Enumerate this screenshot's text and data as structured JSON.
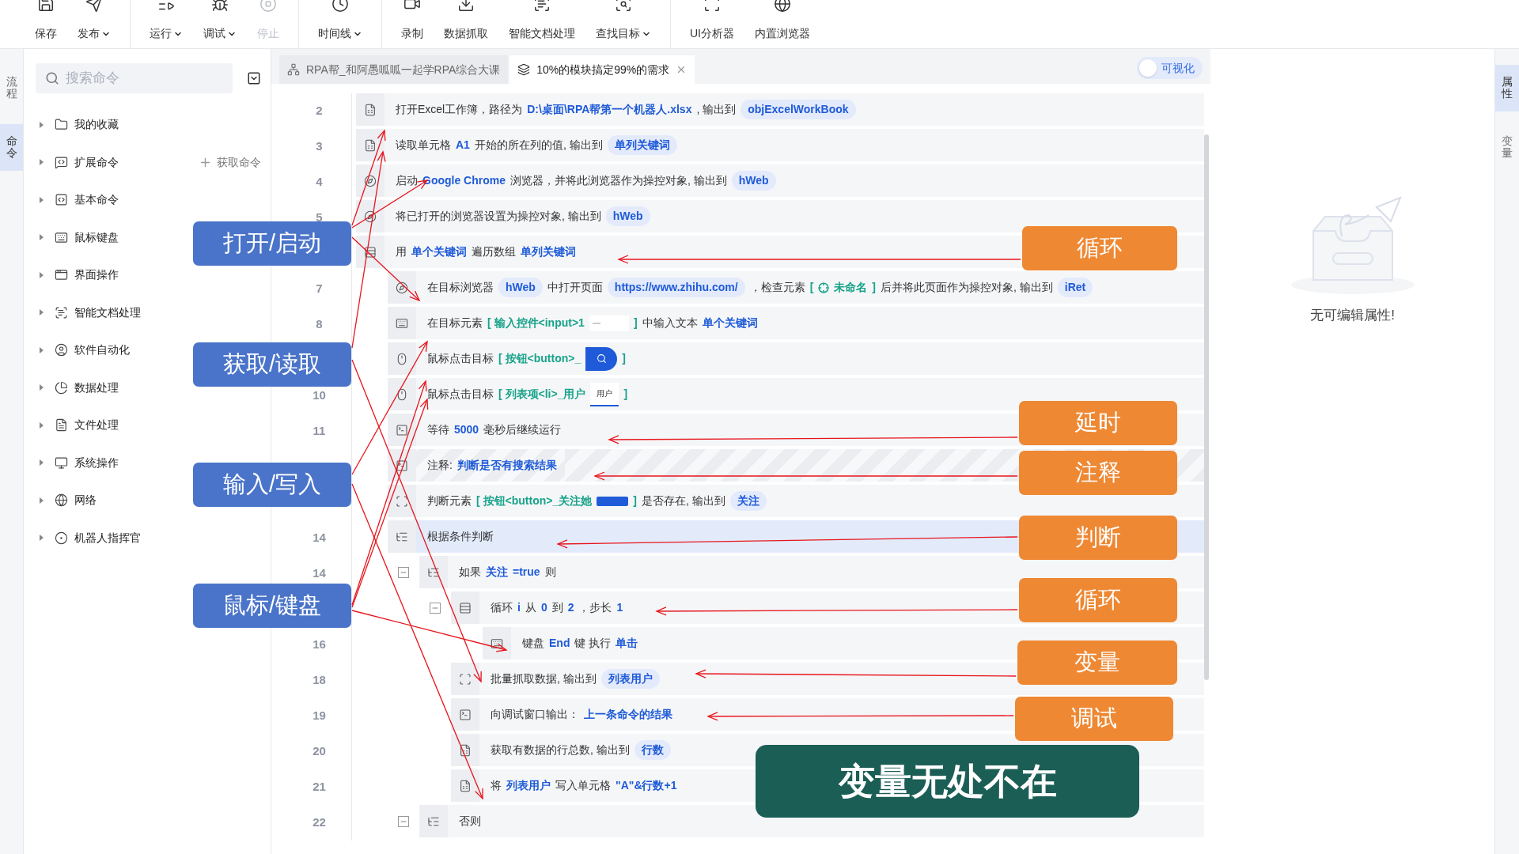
{
  "toolbar": [
    [
      {
        "label": "保存",
        "dropdown": false,
        "disabled": false
      },
      {
        "label": "发布",
        "dropdown": true,
        "disabled": false
      }
    ],
    [
      {
        "label": "运行",
        "dropdown": true,
        "disabled": false
      },
      {
        "label": "调试",
        "dropdown": true,
        "disabled": false
      },
      {
        "label": "停止",
        "dropdown": false,
        "disabled": true
      }
    ],
    [
      {
        "label": "时间线",
        "dropdown": true,
        "disabled": false
      }
    ],
    [
      {
        "label": "录制",
        "dropdown": false,
        "disabled": false
      },
      {
        "label": "数据抓取",
        "dropdown": false,
        "disabled": false
      },
      {
        "label": "智能文档处理",
        "dropdown": false,
        "disabled": false
      },
      {
        "label": "查找目标",
        "dropdown": true,
        "disabled": false
      }
    ],
    [
      {
        "label": "UI分析器",
        "dropdown": false,
        "disabled": false
      },
      {
        "label": "内置浏览器",
        "dropdown": false,
        "disabled": false
      }
    ]
  ],
  "side_tabs": [
    {
      "label": "流程",
      "selected": false
    },
    {
      "label": "命令",
      "selected": true
    }
  ],
  "search": {
    "placeholder": "搜索命令"
  },
  "command_tree": [
    {
      "label": "我的收藏"
    },
    {
      "label": "扩展命令",
      "action": "获取命令"
    },
    {
      "label": "基本命令"
    },
    {
      "label": "鼠标键盘"
    },
    {
      "label": "界面操作"
    },
    {
      "label": "智能文档处理"
    },
    {
      "label": "软件自动化"
    },
    {
      "label": "数据处理"
    },
    {
      "label": "文件处理"
    },
    {
      "label": "系统操作"
    },
    {
      "label": "网络"
    },
    {
      "label": "机器人指挥官"
    }
  ],
  "editor_tabs": [
    {
      "label": "RPA帮_和阿愚呱呱一起学RPA综合大课",
      "selected": false,
      "closable": false
    },
    {
      "label": "10%的模块搞定99%的需求",
      "selected": true,
      "closable": true
    }
  ],
  "visual_toggle": {
    "label": "可视化",
    "on": false
  },
  "rows": [
    {
      "number": "2",
      "kind": "excel",
      "selected": false,
      "parts": [
        {
          "kind": "text",
          "text": "打开Excel工作簿，路径为"
        },
        {
          "kind": "var",
          "text": "D:\\桌面\\RPA帮第一个机器人.xlsx"
        },
        {
          "kind": "text",
          "text": ", 输出到"
        },
        {
          "kind": "pill",
          "text": "objExcelWorkBook"
        }
      ]
    },
    {
      "number": "3",
      "kind": "excel",
      "selected": false,
      "parts": [
        {
          "kind": "text",
          "text": "读取单元格"
        },
        {
          "kind": "var",
          "text": "A1"
        },
        {
          "kind": "text",
          "text": "开始的所在列的值, 输出到"
        },
        {
          "kind": "pill",
          "text": "单列关键词"
        }
      ]
    },
    {
      "number": "4",
      "kind": "browser",
      "selected": false,
      "parts": [
        {
          "kind": "text",
          "text": "启动"
        },
        {
          "kind": "var",
          "text": "Google Chrome"
        },
        {
          "kind": "text",
          "text": "浏览器，并将此浏览器作为操控对象, 输出到"
        },
        {
          "kind": "pill",
          "text": "hWeb"
        }
      ]
    },
    {
      "number": "5",
      "kind": "browser",
      "selected": false,
      "parts": [
        {
          "kind": "text",
          "text": "将已打开的浏览器设置为操控对象, 输出到"
        },
        {
          "kind": "pill",
          "text": "hWeb"
        }
      ]
    },
    {
      "kind": "loop",
      "selected": false,
      "parts": [
        {
          "kind": "text",
          "text": "用"
        },
        {
          "kind": "var",
          "text": "单个关键词"
        },
        {
          "kind": "text",
          "text": "遍历数组"
        },
        {
          "kind": "var",
          "text": "单列关键词"
        }
      ],
      "children": [
        {
          "number": "7",
          "kind": "browser",
          "selected": false,
          "parts": [
            {
              "kind": "text",
              "text": "在目标浏览器"
            },
            {
              "kind": "pill",
              "text": "hWeb"
            },
            {
              "kind": "text",
              "text": "中打开页面"
            },
            {
              "kind": "pill",
              "text": "https://www.zhihu.com/"
            },
            {
              "kind": "text",
              "text": "，检查元素"
            },
            {
              "kind": "elem",
              "text": "["
            },
            {
              "kind": "target"
            },
            {
              "kind": "elem",
              "text": "未命名"
            },
            {
              "kind": "elem",
              "text": "]"
            },
            {
              "kind": "text",
              "text": "后并将此页面作为操控对象, 输出到"
            },
            {
              "kind": "pill",
              "text": "iRet"
            }
          ]
        },
        {
          "number": "8",
          "kind": "keyboard",
          "selected": false,
          "parts": [
            {
              "kind": "text",
              "text": "在目标元素"
            },
            {
              "kind": "elem",
              "text": "[ 输入控件<input>1"
            },
            {
              "kind": "thumb_input"
            },
            {
              "kind": "elem",
              "text": "]"
            },
            {
              "kind": "text",
              "text": "中输入文本"
            },
            {
              "kind": "var",
              "text": "单个关键词"
            }
          ]
        },
        {
          "kind": "mouse",
          "selected": false,
          "parts": [
            {
              "kind": "text",
              "text": "鼠标点击目标"
            },
            {
              "kind": "elem",
              "text": "[ 按钮<button>_"
            },
            {
              "kind": "thumb_search"
            },
            {
              "kind": "elem",
              "text": "]"
            }
          ]
        },
        {
          "number": "10",
          "kind": "mouse",
          "selected": false,
          "parts": [
            {
              "kind": "text",
              "text": "鼠标点击目标"
            },
            {
              "kind": "elem",
              "text": "[ 列表项<li>_用户"
            },
            {
              "kind": "thumb_tab",
              "text": "用户"
            },
            {
              "kind": "elem",
              "text": "]"
            }
          ]
        },
        {
          "number": "11",
          "kind": "console",
          "selected": false,
          "parts": [
            {
              "kind": "text",
              "text": "等待"
            },
            {
              "kind": "var",
              "text": "5000"
            },
            {
              "kind": "text",
              "text": "毫秒后继续运行"
            }
          ]
        },
        {
          "kind": "comment",
          "selected": false,
          "parts": [
            {
              "kind": "text",
              "text": "注释:"
            },
            {
              "kind": "var",
              "text": "判断是否有搜索结果"
            }
          ]
        },
        {
          "kind": "element",
          "selected": false,
          "parts": [
            {
              "kind": "text",
              "text": "判断元素"
            },
            {
              "kind": "elem",
              "text": "[ 按钮<button>_关注她"
            },
            {
              "kind": "thumb_button"
            },
            {
              "kind": "elem",
              "text": "]"
            },
            {
              "kind": "text",
              "text": "是否存在, 输出到"
            },
            {
              "kind": "pill",
              "text": "关注"
            }
          ]
        },
        {
          "number": "14",
          "kind": "condition",
          "selected": true,
          "parts": [
            {
              "kind": "text",
              "text": "根据条件判断"
            }
          ],
          "children": [
            {
              "number": "14",
              "kind": "condition",
              "selected": false,
              "expanded": true,
              "parts": [
                {
                  "kind": "text",
                  "text": "如果"
                },
                {
                  "kind": "var",
                  "text": "关注"
                },
                {
                  "kind": "var",
                  "text": "=true"
                },
                {
                  "kind": "text",
                  "text": "则"
                }
              ],
              "children": [
                {
                  "kind": "loop",
                  "selected": false,
                  "expanded": true,
                  "parts": [
                    {
                      "kind": "text",
                      "text": "循环"
                    },
                    {
                      "kind": "var",
                      "text": "i"
                    },
                    {
                      "kind": "text",
                      "text": "从"
                    },
                    {
                      "kind": "var",
                      "text": "0"
                    },
                    {
                      "kind": "text",
                      "text": "到"
                    },
                    {
                      "kind": "var",
                      "text": "2"
                    },
                    {
                      "kind": "text",
                      "text": "，步长"
                    },
                    {
                      "kind": "var",
                      "text": "1"
                    }
                  ],
                  "children": [
                    {
                      "number": "16",
                      "kind": "keyboard",
                      "selected": false,
                      "parts": [
                        {
                          "kind": "text",
                          "text": "键盘"
                        },
                        {
                          "kind": "var",
                          "text": "End"
                        },
                        {
                          "kind": "text",
                          "text": "键 执行"
                        },
                        {
                          "kind": "var",
                          "text": "单击"
                        }
                      ]
                    }
                  ]
                },
                {
                  "number": "18",
                  "kind": "element",
                  "selected": false,
                  "parts": [
                    {
                      "kind": "text",
                      "text": "批量抓取数据, 输出到"
                    },
                    {
                      "kind": "pill",
                      "text": "列表用户"
                    }
                  ]
                },
                {
                  "number": "19",
                  "kind": "console",
                  "selected": false,
                  "parts": [
                    {
                      "kind": "text",
                      "text": "向调试窗口输出："
                    },
                    {
                      "kind": "var",
                      "text": "上一条命令的结果"
                    }
                  ]
                },
                {
                  "number": "20",
                  "kind": "excel",
                  "selected": false,
                  "parts": [
                    {
                      "kind": "text",
                      "text": "获取有数据的行总数, 输出到"
                    },
                    {
                      "kind": "pill",
                      "text": "行数"
                    }
                  ]
                },
                {
                  "number": "21",
                  "kind": "excel",
                  "selected": false,
                  "parts": [
                    {
                      "kind": "text",
                      "text": "将"
                    },
                    {
                      "kind": "var",
                      "text": "列表用户"
                    },
                    {
                      "kind": "text",
                      "text": "写入单元格"
                    },
                    {
                      "kind": "var",
                      "text": "\"A\"&行数+1"
                    }
                  ]
                }
              ]
            },
            {
              "number": "22",
              "kind": "condition",
              "selected": false,
              "expanded": true,
              "parts": [
                {
                  "kind": "text",
                  "text": "否则"
                }
              ]
            }
          ]
        }
      ]
    }
  ],
  "properties_panel": {
    "empty_text": "无可编辑属性!"
  },
  "right_tabs": [
    {
      "label": "属性",
      "selected": true
    },
    {
      "label": "变量",
      "selected": false
    }
  ],
  "callouts": [
    {
      "text": "打开/启动",
      "kind": "tag",
      "color": "#4a74c9"
    },
    {
      "text": "获取/读取",
      "kind": "tag",
      "color": "#4a74c9"
    },
    {
      "text": "输入/写入",
      "kind": "tag",
      "color": "#4a74c9"
    },
    {
      "text": "鼠标/键盘",
      "kind": "tag",
      "color": "#4a74c9"
    },
    {
      "text": "循环",
      "kind": "tag",
      "color": "#ee8833"
    },
    {
      "text": "延时",
      "kind": "tag",
      "color": "#ee8833"
    },
    {
      "text": "注释",
      "kind": "tag",
      "color": "#ee8833"
    },
    {
      "text": "判断",
      "kind": "tag",
      "color": "#ee8833"
    },
    {
      "text": "循环",
      "kind": "tag",
      "color": "#ee8833"
    },
    {
      "text": "变量",
      "kind": "tag",
      "color": "#ee8833"
    },
    {
      "text": "调试",
      "kind": "tag",
      "color": "#ee8833"
    },
    {
      "text": "变量无处不在",
      "kind": "banner",
      "color": "#1b5e55"
    }
  ]
}
